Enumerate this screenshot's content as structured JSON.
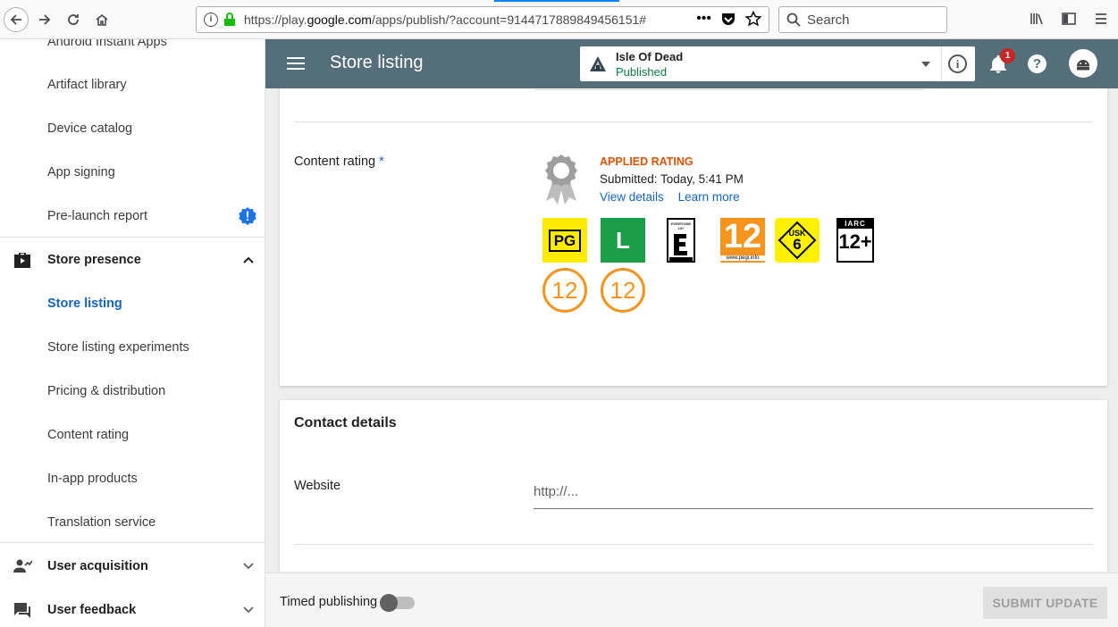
{
  "browser": {
    "url_prefix": "https://play.",
    "url_domain": "google.com",
    "url_rest": "/apps/publish/?account=9144717889849456151#",
    "search_placeholder": "Search"
  },
  "sidebar": {
    "items": [
      {
        "label": "Android Instant Apps"
      },
      {
        "label": "Artifact library"
      },
      {
        "label": "Device catalog"
      },
      {
        "label": "App signing"
      },
      {
        "label": "Pre-launch report"
      },
      {
        "label": "Store presence"
      },
      {
        "label": "Store listing"
      },
      {
        "label": "Store listing experiments"
      },
      {
        "label": "Pricing & distribution"
      },
      {
        "label": "Content rating"
      },
      {
        "label": "In-app products"
      },
      {
        "label": "Translation service"
      },
      {
        "label": "User acquisition"
      },
      {
        "label": "User feedback"
      }
    ]
  },
  "appbar": {
    "title": "Store listing",
    "app_name": "Isle Of Dead",
    "app_status": "Published",
    "notification_count": "1",
    "help_glyph": "?",
    "info_glyph": "i"
  },
  "content_rating": {
    "label": "Content rating",
    "required_marker": "*",
    "applied": "APPLIED RATING",
    "submitted": "Submitted: Today, 5:41 PM",
    "view_details": "View details",
    "learn_more": "Learn more",
    "badges": {
      "classind": "PG",
      "brazil": "L",
      "esrb": "EVERYONE 10+",
      "pegi": "12",
      "pegi_site": "www.pegi.info",
      "usk_label": "USK",
      "usk": "6",
      "iarc_label": "IARC",
      "iarc": "12+",
      "circle1": "12",
      "circle2": "12"
    }
  },
  "contact": {
    "title": "Contact details",
    "website_label": "Website",
    "website_placeholder": "http://..."
  },
  "bottom": {
    "timed_publishing": "Timed publishing",
    "submit": "SUBMIT UPDATE"
  },
  "colors": {
    "appbar": "#546e7a",
    "accent": "#1565c0",
    "published": "#0b8043",
    "applied": "#e65100"
  }
}
